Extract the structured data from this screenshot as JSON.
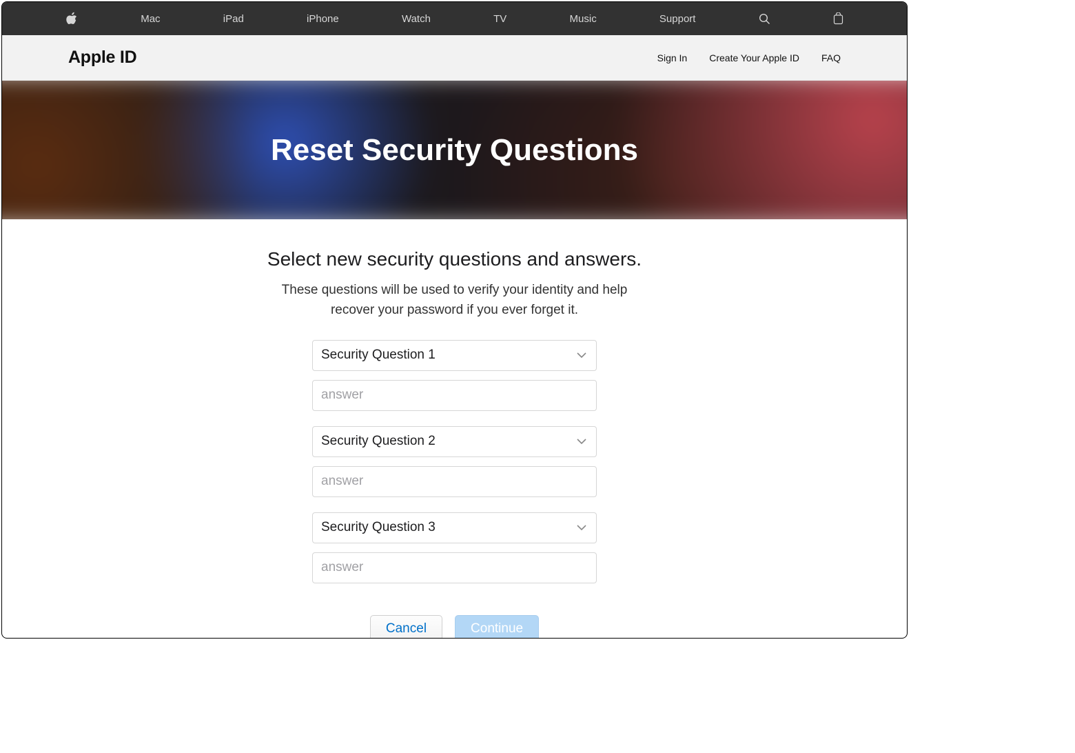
{
  "global_nav": {
    "items": [
      "Mac",
      "iPad",
      "iPhone",
      "Watch",
      "TV",
      "Music",
      "Support"
    ]
  },
  "sub_nav": {
    "title": "Apple ID",
    "links": [
      "Sign In",
      "Create Your Apple ID",
      "FAQ"
    ]
  },
  "hero": {
    "title": "Reset Security Questions"
  },
  "main": {
    "heading": "Select new security questions and answers.",
    "subheading": "These questions will be used to verify your identity and help recover your password if you ever forget it."
  },
  "form": {
    "questions": [
      {
        "label": "Security Question 1",
        "answer_placeholder": "answer"
      },
      {
        "label": "Security Question 2",
        "answer_placeholder": "answer"
      },
      {
        "label": "Security Question 3",
        "answer_placeholder": "answer"
      }
    ]
  },
  "buttons": {
    "cancel": "Cancel",
    "continue": "Continue"
  }
}
